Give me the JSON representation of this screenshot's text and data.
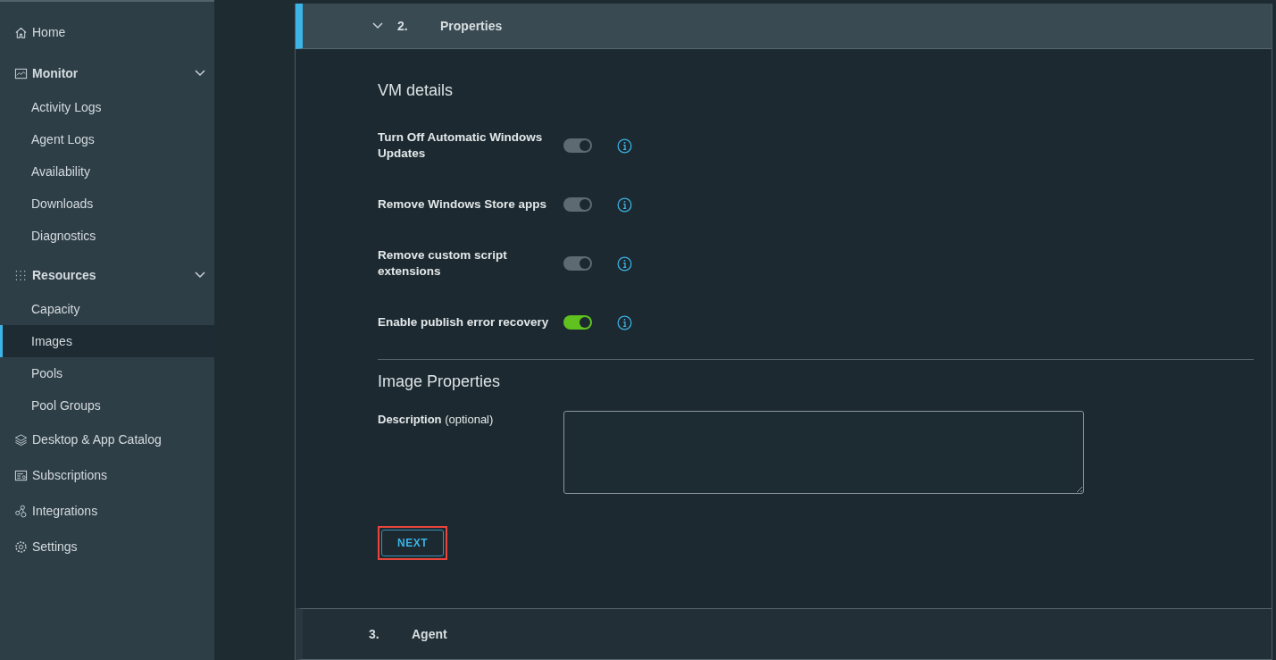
{
  "sidebar": {
    "items": [
      {
        "kind": "link",
        "label": "Home",
        "selected": false
      },
      {
        "kind": "group",
        "label": "Monitor",
        "expanded": true,
        "children": [
          {
            "label": "Activity Logs",
            "selected": false
          },
          {
            "label": "Agent Logs",
            "selected": false
          },
          {
            "label": "Availability",
            "selected": false
          },
          {
            "label": "Downloads",
            "selected": false
          },
          {
            "label": "Diagnostics",
            "selected": false
          }
        ]
      },
      {
        "kind": "group",
        "label": "Resources",
        "expanded": true,
        "children": [
          {
            "label": "Capacity",
            "selected": false
          },
          {
            "label": "Images",
            "selected": true
          },
          {
            "label": "Pools",
            "selected": false
          },
          {
            "label": "Pool Groups",
            "selected": false
          }
        ]
      },
      {
        "kind": "link",
        "label": "Desktop & App Catalog",
        "selected": false
      },
      {
        "kind": "link",
        "label": "Subscriptions",
        "selected": false
      },
      {
        "kind": "link",
        "label": "Integrations",
        "selected": false
      },
      {
        "kind": "link",
        "label": "Settings",
        "selected": false
      }
    ]
  },
  "steps": [
    {
      "number": "2.",
      "title": "Properties",
      "expanded": true,
      "selected": true,
      "sections": [
        {
          "title": "VM details",
          "toggles": [
            {
              "label": "Turn Off Automatic Windows Updates",
              "on": true,
              "disabled": true
            },
            {
              "label": "Remove Windows Store apps",
              "on": true,
              "disabled": true
            },
            {
              "label": "Remove custom script extensions",
              "on": true,
              "disabled": true
            },
            {
              "label": "Enable publish error recovery",
              "on": true,
              "disabled": false
            }
          ]
        },
        {
          "title": "Image Properties",
          "field": {
            "label": "Description",
            "hint": "(optional)"
          }
        }
      ],
      "button": {
        "label": "NEXT",
        "highlighted": true
      }
    },
    {
      "number": "3.",
      "title": "Agent",
      "expanded": false,
      "selected": false
    }
  ]
}
